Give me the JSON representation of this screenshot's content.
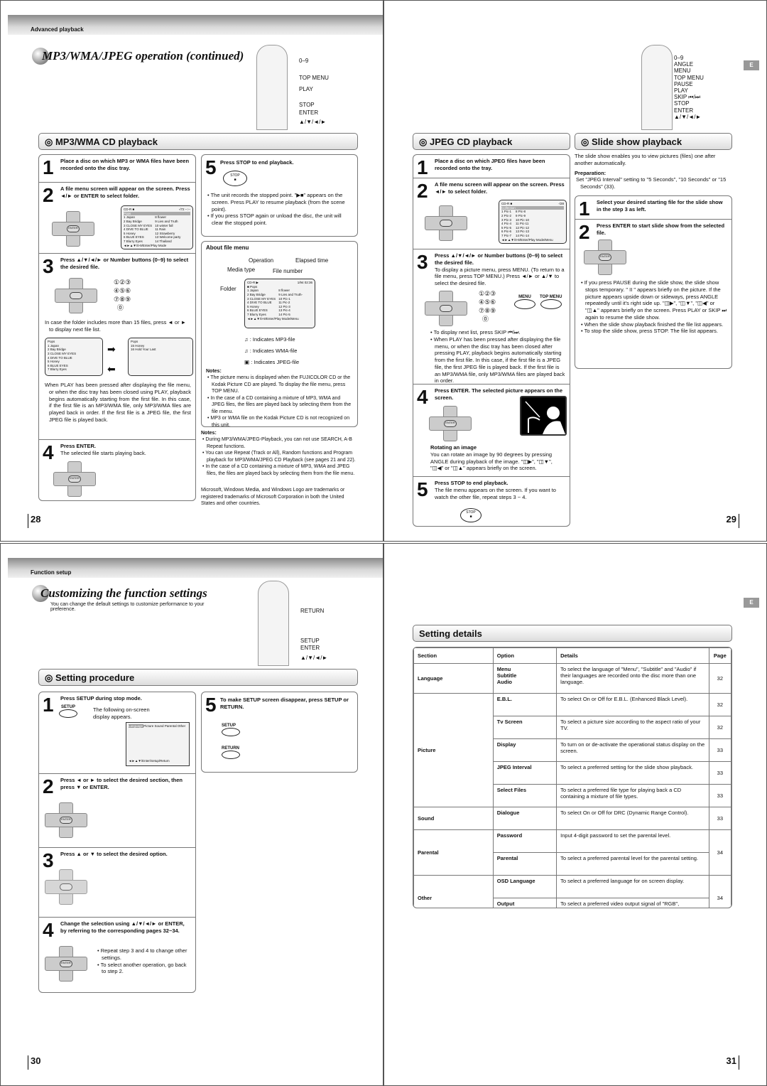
{
  "page28": {
    "section_header": "Advanced playback",
    "title": "MP3/WMA/JPEG operation (continued)",
    "remote_labels": [
      "0–9",
      "TOP MENU",
      "PLAY",
      "STOP",
      "ENTER",
      "▲/▼/◄/►"
    ],
    "mp3_section": "MP3/WMA CD playback",
    "steps": [
      {
        "num": "1",
        "text": "Place a disc on which MP3 or WMA files have been recorded onto the disc tray."
      },
      {
        "num": "2",
        "text": "A file menu screen will appear on the screen. Press ◄/► or ENTER to select folder."
      },
      {
        "num": "3",
        "text": "Press ▲/▼/◄/► or Number buttons (0–9) to select the desired file."
      },
      {
        "num": "4",
        "text": "Press ENTER.",
        "sub": "The selected file starts playing back."
      },
      {
        "num": "5",
        "text": "Press STOP to end playback."
      }
    ],
    "step3_bullet": "In case the folder includes more than 15 files, press ◄ or ► to display next file list.",
    "step3_bullet2": "When PLAY has been pressed after displaying the file menu, or when the disc tray has been closed using PLAY, playback begins automatically starting from the first file. In this case, if the first file is an MP3/WMA file, only MP3/WMA files are played back in order. If the first file is a JPEG file, the first JPEG file is played back.",
    "step5_bullets": [
      "The unit records the stopped point. \"▶■\" appears on the screen. Press PLAY to resume playback (from the scene point).",
      "If you press STOP again or unload the disc, the unit will clear the stopped point."
    ],
    "stop_button": "STOP",
    "enter_button": "ENTER",
    "file_menu_screen": {
      "header": "CD-R ■",
      "counter": "-/72  --:--",
      "folder": "Pops",
      "files_left": [
        "1 Japan",
        "2 Bay Bridge",
        "3 CLOSE MY EYES",
        "4 DIVE TO BLUE",
        "5 Honey",
        "6 BLUE EYES",
        "7 Blurry Eyes"
      ],
      "files_right": [
        "8 flower",
        "9 Lies and Truth",
        "10 winter fall",
        "11 Rain",
        "12 Strawberry",
        "13 Welcome party",
        "14 Thailand"
      ],
      "footer": "◄►▲▼/0-9/Enter/Play Mode"
    },
    "next_screen": {
      "files": [
        "15 Honey",
        "16 Hold Your Last"
      ],
      "footer": "◄►▲▼/0-9/Enter/Play Mode"
    },
    "about_file_menu": {
      "title": "About file menu",
      "labels": [
        "Operation",
        "Elapsed time",
        "Media type",
        "File number",
        "Folder"
      ],
      "screen_header": "CD-R ▶",
      "screen_counter": "1/94  02:36",
      "files_left": [
        "1 Japan",
        "2 Bay Bridge",
        "3 CLOSE MY EYES",
        "4 DIVE TO BLUE",
        "5 Honey",
        "6 BLUE EYES",
        "7 Blurry Eyes"
      ],
      "files_right": [
        "8 flower",
        "9 Lies and Truth-",
        "10 Pic-1",
        "11 Pic-2",
        "12 Pic-3",
        "13 Pic-4",
        "14 Pic-5"
      ],
      "footer": "◄►▲▼/0-9/Enter/Play Mode/Menu",
      "legend": [
        ": Indicates MP3-file",
        ": Indicates WMA-file",
        ": Indicates JPEG-file"
      ]
    },
    "box_notes_title": "Notes:",
    "box_notes": [
      "The picture menu is displayed when the FUJICOLOR CD or the Kodak Picture CD are played. To display the file menu, press TOP MENU.",
      "In the case of a CD containing a mixture of MP3, WMA and JPEG files, the files are played back by selecting them from the file menu.",
      "MP3 or WMA file on the Kodak Picture CD is not recognized on this unit."
    ],
    "notes_title": "Notes:",
    "notes": [
      "During MP3/WMA/JPEG-Playback, you can not use SEARCH, A-B Repeat functions.",
      "You can use Repeat (Track or All), Random functions and Program playback for MP3/WMA/JPEG CD Playback (see pages 21 and 22).",
      "In the case of a CD containing a mixture of MP3, WMA and JPEG files, the files are played back by selecting them from the file menu."
    ],
    "trademark": "Microsoft, Windows Media, and Windows Logo are trademarks or registered trademarks of Microsoft Corporation in both the United States and other countries.",
    "page_number": "28"
  },
  "page29": {
    "remote_labels": [
      "0–9",
      "ANGLE",
      "MENU",
      "TOP MENU",
      "PAUSE",
      "PLAY",
      "SKIP ⏮/⏭",
      "STOP",
      "ENTER",
      "▲/▼/◄/►"
    ],
    "lang_tab": "E",
    "jpeg_section": "JPEG CD playback",
    "steps": [
      {
        "num": "1",
        "text": "Place a disc on which JPEG files have been recorded onto the tray."
      },
      {
        "num": "2",
        "text": "A file menu screen will appear on the screen. Press ◄/► to select folder."
      },
      {
        "num": "3",
        "text": "Press ▲/▼/◄/► or Number buttons (0–9) to select the desired file.",
        "sub": "To display a picture menu, press MENU. (To return to a file menu, press TOP MENU.) Press ◄/► or ▲/▼ to select the desired file."
      },
      {
        "num": "4",
        "text": "Press ENTER. The selected picture appears on the screen."
      },
      {
        "num": "5",
        "text": "Press STOP to end playback.",
        "sub": "The file menu appears on the screen. If you want to watch the other file, repeat steps 3 ~ 4."
      }
    ],
    "jpeg_screen": {
      "header": "CD-R ■",
      "counter": "-/28",
      "folder": "Collection",
      "files_left": [
        "1 Pic-1",
        "2 Pic-2",
        "3 Pic-3",
        "4 Pic-4",
        "5 Pic-5",
        "6 Pic-6",
        "7 Pic-7"
      ],
      "files_right": [
        "8 Pic-8",
        "9 Pic-9",
        "10 Pic-10",
        "11 Pic-11",
        "12 Pic-12",
        "13 Pic-13",
        "14 Pic-14"
      ],
      "footer": "◄►▲▼/0-9/Enter/Play Mode/Menu"
    },
    "menu_label": "MENU",
    "top_menu_label": "TOP MENU",
    "step3_bullets": [
      "To display next list, press SKIP ⏮/⏭.",
      "When PLAY has been pressed after displaying the file menu, or when the disc tray has been closed after pressing PLAY, playback begins automatically starting from the first file. In this case, if the first file is a JPEG file, the first JPEG file is played back. If the first file is an MP3/WMA file, only MP3/WMA files are played back in order."
    ],
    "rotate_title": "Rotating an image",
    "rotate_text": "You can rotate an image by 90 degrees by pressing ANGLE during playback of the image. \"◫▶\", \"◫▼\", \"◫◀\" or \"◫▲\" appears briefly on the screen.",
    "stop_button": "STOP",
    "slide_section": "Slide show playback",
    "slide_intro": "The slide show enables you to view pictures (files) one after another automatically.",
    "prep_title": "Preparation:",
    "prep_text": "Set \"JPEG Interval\" setting to \"5 Seconds\", \"10 Seconds\" or \"15 Seconds\" (33).",
    "slide_steps": [
      {
        "num": "1",
        "text": "Select your desired starting file for the slide show in the step 3 as left."
      },
      {
        "num": "2",
        "text": "Press ENTER to start slide show from the selected file."
      }
    ],
    "slide_bullets": [
      "If you press PAUSE during the slide show, the slide show stops temporary. \" II \" appears briefly on the picture. If the picture appears upside down or sideways, press ANGLE repeatedly until it's right side up. \"◫▶\", \"◫▼\", \"◫◀\" or \"◫▲\" appears briefly on the screen. Press PLAY or SKIP ⏭ again to resume the slide show.",
      "When the slide show playback finished the file list appears.",
      "To stop the slide show, press STOP. The file list appears."
    ],
    "page_number": "29"
  },
  "page30": {
    "section_header": "Function setup",
    "title": "Customizing the function settings",
    "intro": "You can change the default settings to customize performance to your preference.",
    "remote_labels": [
      "RETURN",
      "SETUP",
      "ENTER",
      "▲/▼/◄/►"
    ],
    "procedure_section": "Setting procedure",
    "steps": [
      {
        "num": "1",
        "text": "Press SETUP during stop mode.",
        "sub": "The following on-screen display appears."
      },
      {
        "num": "2",
        "text": "Press ◄ or ► to select the desired section, then press ▼ or ENTER."
      },
      {
        "num": "3",
        "text": "Press ▲ or ▼ to select the desired option."
      },
      {
        "num": "4",
        "text": "Change the selection using ▲/▼/◄/► or ENTER, by referring to the corresponding pages 32~34."
      },
      {
        "num": "5",
        "text": "To make SETUP screen disappear, press SETUP or RETURN."
      }
    ],
    "setup_screen": {
      "tabs": [
        "Language",
        "Picture",
        "Sound",
        "Parental",
        "Other"
      ],
      "footer": "◄►▲▼/Enter/Setup/Return"
    },
    "setup_label": "SETUP",
    "return_label": "RETURN",
    "step4_bullets": [
      "Repeat step 3 and 4 to change other settings.",
      "To select another operation, go back to step 2."
    ],
    "page_number": "30"
  },
  "page31": {
    "lang_tab": "E",
    "details_section": "Setting details",
    "table": {
      "headers": [
        "Section",
        "Option",
        "Details",
        "Page"
      ],
      "groups": [
        {
          "section": "Language",
          "rows": [
            {
              "option": "Menu\nSubtitle\nAudio",
              "details": "To select the language of \"Menu\", \"Subtitle\" and \"Audio\" if their languages are recorded onto the disc more than one language.",
              "page": "32"
            }
          ]
        },
        {
          "section": "Picture",
          "rows": [
            {
              "option": "E.B.L.",
              "details": "To select On or Off for E.B.L. (Enhanced Black Level).",
              "page": "32"
            },
            {
              "option": "Tv Screen",
              "details": "To select a picture size according to the aspect ratio of your TV.",
              "page": "32"
            },
            {
              "option": "Display",
              "details": "To turn on or de-activate the operational status display on the screen.",
              "page": "33"
            },
            {
              "option": "JPEG Interval",
              "details": "To select a preferred setting for the slide show playback.",
              "page": "33"
            },
            {
              "option": "Select Files",
              "details": "To select a preferred file type for playing back a CD containing a mixture of file types.",
              "page": "33"
            }
          ]
        },
        {
          "section": "Sound",
          "rows": [
            {
              "option": "Dialogue",
              "details": "To select On or Off for DRC (Dynamic Range Control).",
              "page": "33"
            }
          ]
        },
        {
          "section": "Parental",
          "page": "34",
          "rows": [
            {
              "option": "Password",
              "details": "Input 4-digit password to set the parental level."
            },
            {
              "option": "Parental",
              "details": "To select a preferred parental level for the parental setting."
            }
          ]
        },
        {
          "section": "Other",
          "page": "34",
          "rows": [
            {
              "option": "OSD Language",
              "details": "To select a preferred language for on screen display."
            },
            {
              "option": "Output",
              "details": "To select a preferred video output signal of \"RGB\", \"Component\" or \"Progressive\"."
            }
          ]
        }
      ]
    },
    "page_number": "31"
  }
}
